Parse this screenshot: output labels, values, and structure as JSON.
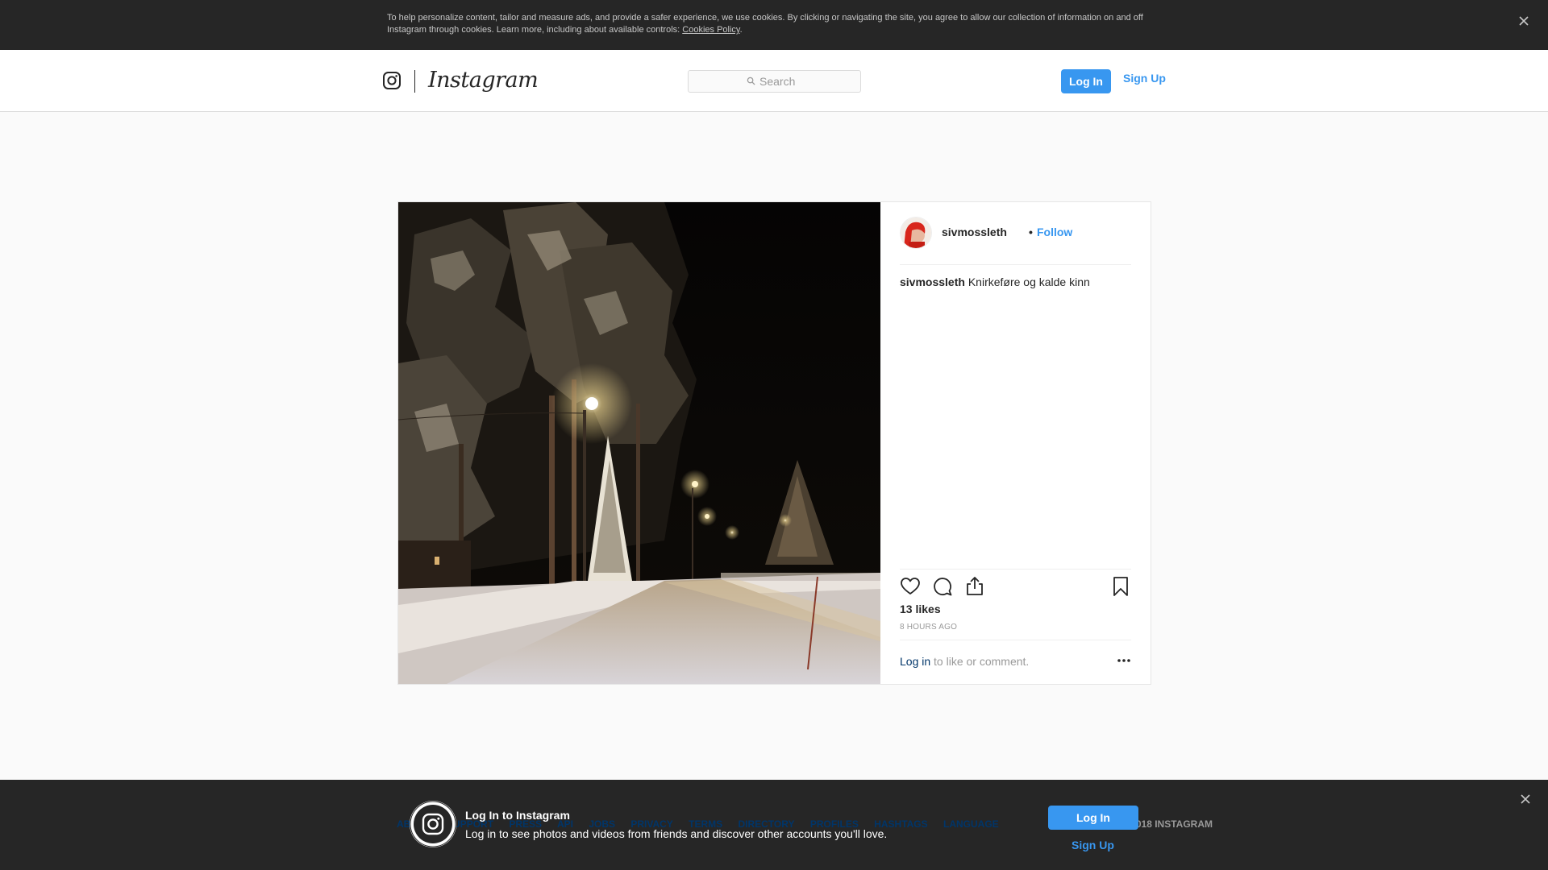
{
  "cookie_banner": {
    "text": "To help personalize content, tailor and measure ads, and provide a safer experience, we use cookies. By clicking or navigating the site, you agree to allow our collection of information on and off Instagram through cookies. Learn more, including about available controls: ",
    "link_label": "Cookies Policy",
    "suffix": ".",
    "close_icon": "close-icon"
  },
  "nav": {
    "logo_text": "Instagram",
    "search_placeholder": "Search",
    "login_label": "Log In",
    "signup_label": "Sign Up"
  },
  "post": {
    "username": "sivmossleth",
    "dot": "•",
    "follow_label": "Follow",
    "caption": "Knirkeføre og kalde kinn",
    "likes": "13 likes",
    "time": "8 HOURS AGO",
    "comment_login_label": "Log in",
    "comment_suffix": " to like or comment.",
    "icons": [
      "heart-icon",
      "comment-icon",
      "share-icon",
      "bookmark-icon",
      "more-icon"
    ]
  },
  "footer": {
    "links": [
      "ABOUT",
      "SUPPORT",
      "PRESS",
      "API",
      "JOBS",
      "PRIVACY",
      "TERMS",
      "DIRECTORY",
      "PROFILES",
      "HASHTAGS",
      "LANGUAGE"
    ],
    "copyright": "© 2018 INSTAGRAM"
  },
  "login_bar": {
    "title": "Log In to Instagram",
    "description": "Log in to see photos and videos from friends and discover other accounts you'll love.",
    "login_label": "Log In",
    "signup_label": "Sign Up"
  },
  "colors": {
    "accent": "#3897f0",
    "dark_bar": "#262626",
    "background": "#fafafa"
  }
}
